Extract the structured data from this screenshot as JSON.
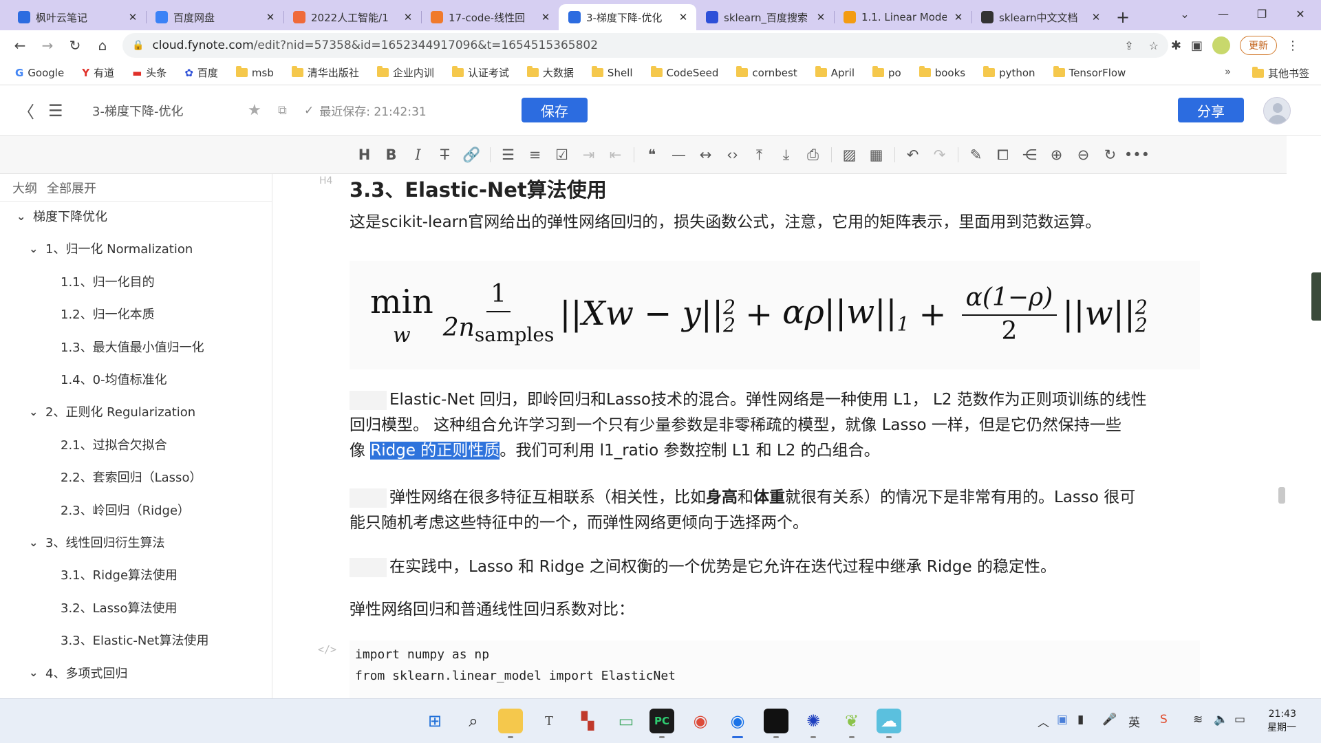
{
  "browser": {
    "tabs": [
      {
        "title": "枫叶云笔记",
        "favicon": "note-icon",
        "color": "#2c6ce0",
        "active": false
      },
      {
        "title": "百度网盘",
        "favicon": "baidu-pan-icon",
        "color": "#3b82f6",
        "active": false
      },
      {
        "title": "2022人工智能/1",
        "favicon": "spinner-icon",
        "color": "#ef6a3a",
        "active": false
      },
      {
        "title": "17-code-线性回",
        "favicon": "orange-icon",
        "color": "#f07a2c",
        "active": false
      },
      {
        "title": "3-梯度下降-优化",
        "favicon": "note-icon",
        "color": "#2c6ce0",
        "active": true
      },
      {
        "title": "sklearn_百度搜索",
        "favicon": "baidu-icon",
        "color": "#2d4fd8",
        "active": false
      },
      {
        "title": "1.1. Linear Mode",
        "favicon": "chart-icon",
        "color": "#f39c12",
        "active": false
      },
      {
        "title": "sklearn中文文档",
        "favicon": "book-icon",
        "color": "#333333",
        "active": false
      }
    ],
    "url_host": "cloud.fynote.com",
    "url_path": "/edit?nid=57358&id=1652344917096&t=1654515365802",
    "update_label": "更新",
    "bookmarks": [
      {
        "label": "Google",
        "icon": "google-icon"
      },
      {
        "label": "有道",
        "icon": "youdao-icon"
      },
      {
        "label": "头条",
        "icon": "toutiao-icon"
      },
      {
        "label": "百度",
        "icon": "baidu-icon"
      },
      {
        "label": "msb",
        "icon": "folder-icon"
      },
      {
        "label": "清华出版社",
        "icon": "folder-icon"
      },
      {
        "label": "企业内训",
        "icon": "folder-icon"
      },
      {
        "label": "认证考试",
        "icon": "folder-icon"
      },
      {
        "label": "大数据",
        "icon": "folder-icon"
      },
      {
        "label": "Shell",
        "icon": "folder-icon"
      },
      {
        "label": "CodeSeed",
        "icon": "folder-icon"
      },
      {
        "label": "cornbest",
        "icon": "folder-icon"
      },
      {
        "label": "April",
        "icon": "folder-icon"
      },
      {
        "label": "po",
        "icon": "folder-icon"
      },
      {
        "label": "books",
        "icon": "folder-icon"
      },
      {
        "label": "python",
        "icon": "folder-icon"
      },
      {
        "label": "TensorFlow",
        "icon": "folder-icon"
      }
    ],
    "bookmarks_more": "»",
    "other_bookmarks": "其他书签"
  },
  "app": {
    "doc_title": "3-梯度下降-优化",
    "last_saved": "最近保存: 21:42:31",
    "save_label": "保存",
    "share_label": "分享",
    "accent": "#2c6ce0"
  },
  "sidebar": {
    "outline_label": "大纲",
    "expand_all_label": "全部展开",
    "items": [
      {
        "label": "梯度下降优化",
        "level": 0,
        "caret": true
      },
      {
        "label": "1、归一化 Normalization",
        "level": 1,
        "caret": true
      },
      {
        "label": "1.1、归一化目的",
        "level": 2,
        "caret": false
      },
      {
        "label": "1.2、归一化本质",
        "level": 2,
        "caret": false
      },
      {
        "label": "1.3、最大值最小值归一化",
        "level": 2,
        "caret": false
      },
      {
        "label": "1.4、0-均值标准化",
        "level": 2,
        "caret": false
      },
      {
        "label": "2、正则化 Regularization",
        "level": 1,
        "caret": true
      },
      {
        "label": "2.1、过拟合欠拟合",
        "level": 2,
        "caret": false
      },
      {
        "label": "2.2、套索回归（Lasso）",
        "level": 2,
        "caret": false
      },
      {
        "label": "2.3、岭回归（Ridge）",
        "level": 2,
        "caret": false
      },
      {
        "label": "3、线性回归衍生算法",
        "level": 1,
        "caret": true
      },
      {
        "label": "3.1、Ridge算法使用",
        "level": 2,
        "caret": false
      },
      {
        "label": "3.2、Lasso算法使用",
        "level": 2,
        "caret": false
      },
      {
        "label": "3.3、Elastic-Net算法使用",
        "level": 2,
        "caret": false
      },
      {
        "label": "4、多项式回归",
        "level": 1,
        "caret": true
      }
    ]
  },
  "content": {
    "heading_tag": "H4",
    "heading": "3.3、Elastic-Net算法使用",
    "intro": "这是scikit-learn官网给出的弹性网络回归的，损失函数公式，注意，它用的矩阵表示，里面用到范数运算。",
    "formula": {
      "min": "min",
      "min_sub": "w",
      "frac1_num": "1",
      "frac1_den_n": "2n",
      "frac1_den_sub": "samples",
      "term1": "||Xw − y||",
      "term1_sub": "2",
      "term1_sup": "2",
      "plus1": "+",
      "term2": "αρ||w||",
      "term2_sub": "1",
      "plus2": "+",
      "frac2_num": "α(1−ρ)",
      "frac2_den": "2",
      "term3": "||w||",
      "term3_sub": "2",
      "term3_sup": "2"
    },
    "p1_line1": "Elastic-Net 回归，即岭回归和Lasso技术的混合。弹性网络是一种使用 L1，  L2 范数作为正则项训练的线性",
    "p1_line2": "回归模型。 这种组合允许学习到一个只有少量参数是非零稀疏的模型，就像 Lasso 一样，但是它仍然保持一些",
    "p1_line3_pre": "像 ",
    "p1_line3_hl": "Ridge 的正则性质",
    "p1_line3_post": "。我们可利用 l1_ratio 参数控制 L1 和 L2 的凸组合。",
    "p2_line1_a": "弹性网络在很多特征互相联系（相关性，比如",
    "p2_line1_b1": "身高",
    "p2_line1_c": "和",
    "p2_line1_b2": "体重",
    "p2_line1_d": "就很有关系）的情况下是非常有用的。Lasso 很可",
    "p2_line2": "能只随机考虑这些特征中的一个，而弹性网络更倾向于选择两个。",
    "p3": "在实践中，Lasso 和 Ridge 之间权衡的一个优势是它允许在迭代过程中继承 Ridge 的稳定性。",
    "p4": "弹性网络回归和普通线性回归系数对比：",
    "code_icon": "</>",
    "code": [
      "import numpy as np",
      "from sklearn.linear_model import ElasticNet"
    ]
  },
  "taskbar": {
    "time": "21:43",
    "day": "星期一",
    "ime": "英"
  }
}
